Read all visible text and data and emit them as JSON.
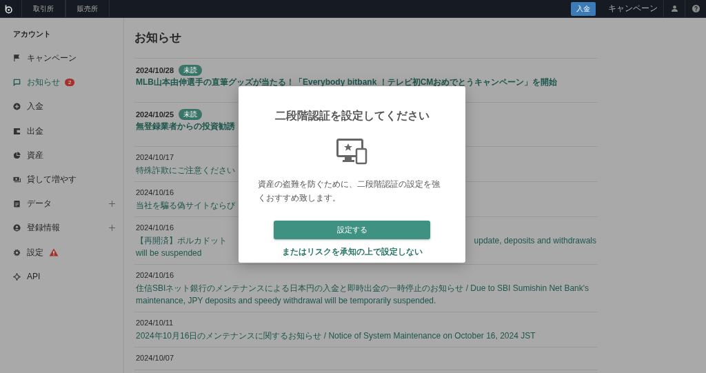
{
  "topbar": {
    "tabs": [
      {
        "label": "取引所",
        "selected": false
      },
      {
        "label": "販売所",
        "selected": false
      }
    ],
    "deposit_button": "入金",
    "campaign_link": "キャンペーン"
  },
  "sidebar": {
    "heading": "アカウント",
    "items": [
      {
        "label": "キャンペーン",
        "selected": false
      },
      {
        "label": "お知らせ",
        "selected": true,
        "badge": "2"
      },
      {
        "label": "入金",
        "selected": false
      },
      {
        "label": "出金",
        "selected": false
      },
      {
        "label": "資産",
        "selected": false
      },
      {
        "label": "貸して増やす",
        "selected": false
      },
      {
        "label": "データ",
        "selected": false,
        "expandable": true
      },
      {
        "label": "登録情報",
        "selected": false,
        "expandable": true
      },
      {
        "label": "設定",
        "selected": false,
        "warning": true
      },
      {
        "label": "API",
        "selected": false
      }
    ]
  },
  "page_title": "お知らせ",
  "notices": [
    {
      "date": "2024/10/28",
      "unread": true,
      "unread_label": "未読",
      "lines": [
        [
          "MLB山本由伸選手の直筆グッズが当たる！「Everybody bitbank ！テレビ初CMおめでとうキャンペーン」を開始"
        ]
      ]
    },
    {
      "date": "2024/10/25",
      "unread": true,
      "unread_label": "未読",
      "lines": [
        [
          "無登録業者からの投資勧誘"
        ]
      ]
    },
    {
      "date": "2024/10/17",
      "unread": false,
      "lines": [
        [
          "特殊詐欺にご注意ください"
        ]
      ]
    },
    {
      "date": "2024/10/16",
      "unread": false,
      "lines": [
        [
          "当社を騙る偽サイトならび"
        ]
      ]
    },
    {
      "date": "2024/10/16",
      "unread": false,
      "lines": [
        [
          "【再開済】ポルカドット",
          "update, deposits and withdrawals"
        ],
        [
          "will be suspended"
        ]
      ]
    },
    {
      "date": "2024/10/16",
      "unread": false,
      "lines": [
        [
          "住信SBIネット銀行のメンテナンスによる日本円の入金と即時出金の一時停止のお知らせ / Due to SBI Sumishin Net Bank's maintenance, JPY deposits and speedy withdrawal will be temporarily suspended."
        ]
      ]
    },
    {
      "date": "2024/10/11",
      "unread": false,
      "lines": [
        [
          "2024年10月16日のメンテナンスに関するお知らせ / Notice of System Maintenance on October 16, 2024 JST"
        ]
      ]
    },
    {
      "date": "2024/10/07",
      "unread": false
    }
  ],
  "modal": {
    "title": "二段階認証を設定してください",
    "message": "資産の盗難を防ぐために、二段階認証の設定を強くおすすめ致します。",
    "primary_button": "設定する",
    "skip_link": "またはリスクを承知の上で設定しない"
  }
}
